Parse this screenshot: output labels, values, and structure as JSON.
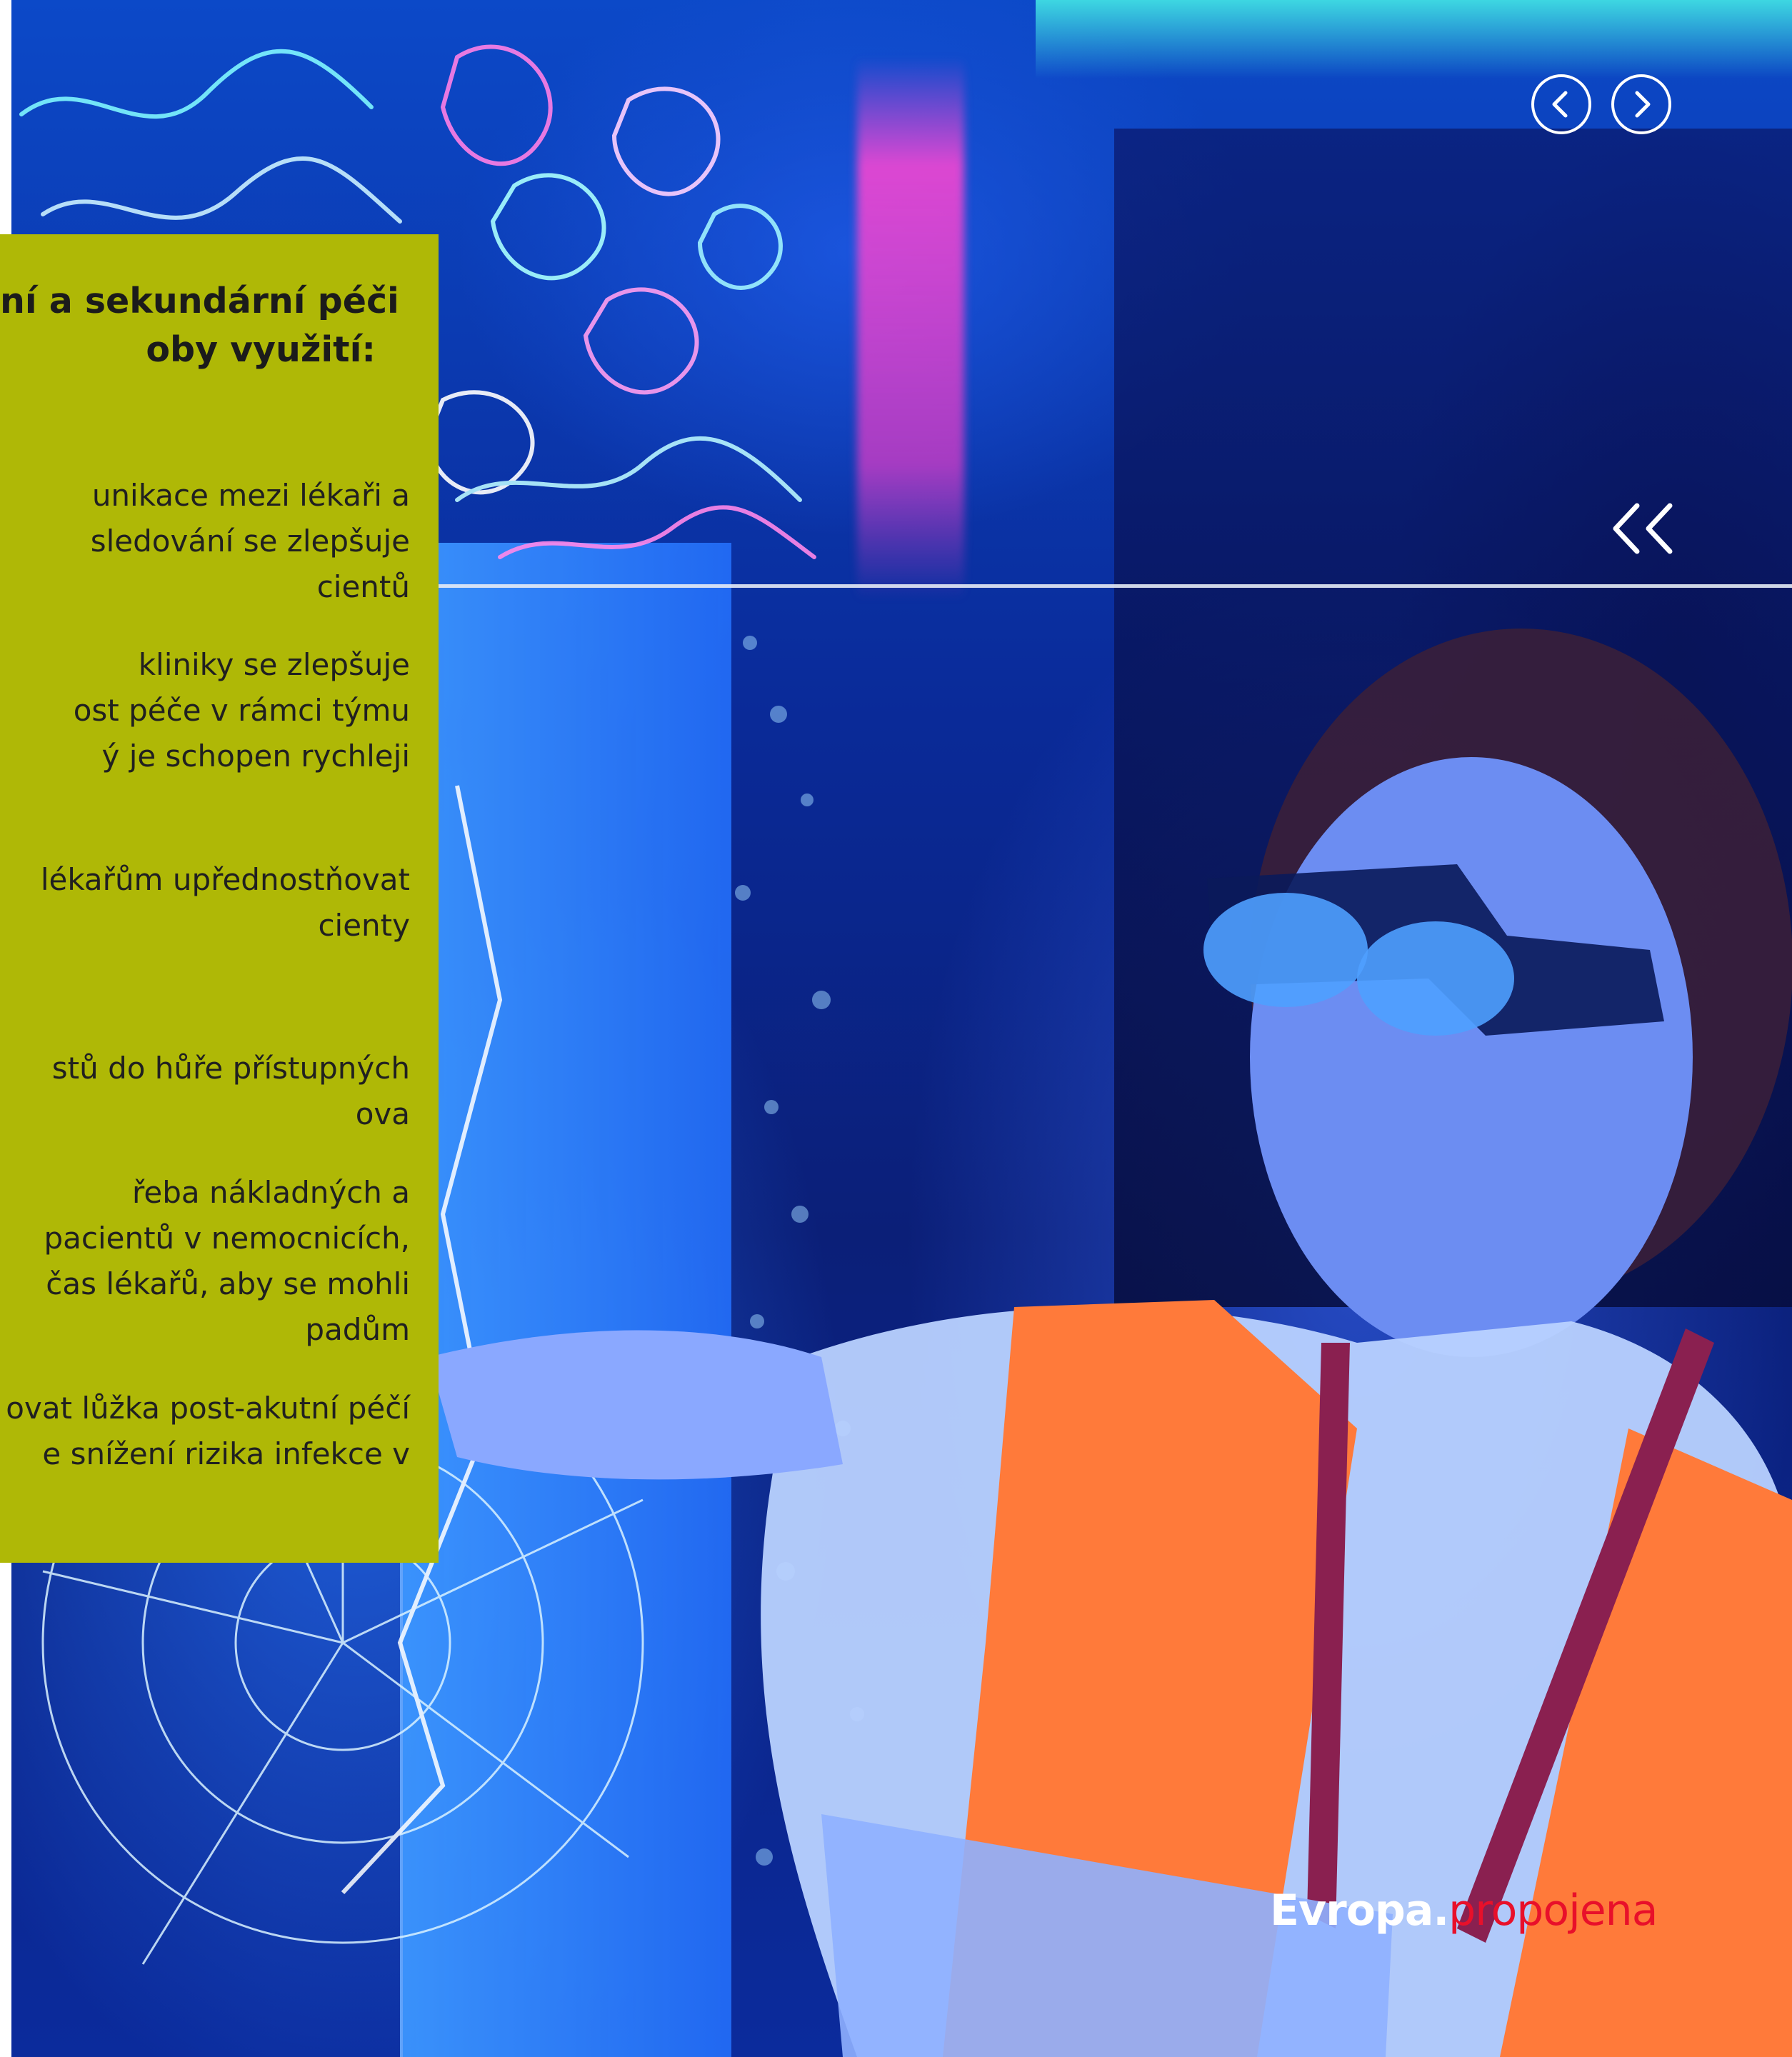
{
  "overlay": {
    "title_lines": "ní a sekundární péči\noby využití:",
    "benefits": [
      "unikace mezi lékaři a\nsledování se zlepšuje\ncientů",
      "kliniky se zlepšuje\nost péče v rámci týmu\ný je schopen rychleji",
      "lékařům upřednostňovat\ncienty",
      "stů do hůře přístupných\nova",
      "řeba nákladných a\npacientů v nemocnicích,\nčas lékařů, aby se mohli\npadům",
      "ovat lůžka post-akutní péčí\ne snížení rizika infekce v"
    ],
    "background": "#afb806"
  },
  "nav": {
    "prev_icon": "chevron-left-icon",
    "next_icon": "chevron-right-icon",
    "collapse_icon": "double-chevron-left-icon"
  },
  "brand": {
    "part1": "Evropa.",
    "part2": "propojena",
    "color1": "#ffffff",
    "color2": "#e8102a"
  }
}
